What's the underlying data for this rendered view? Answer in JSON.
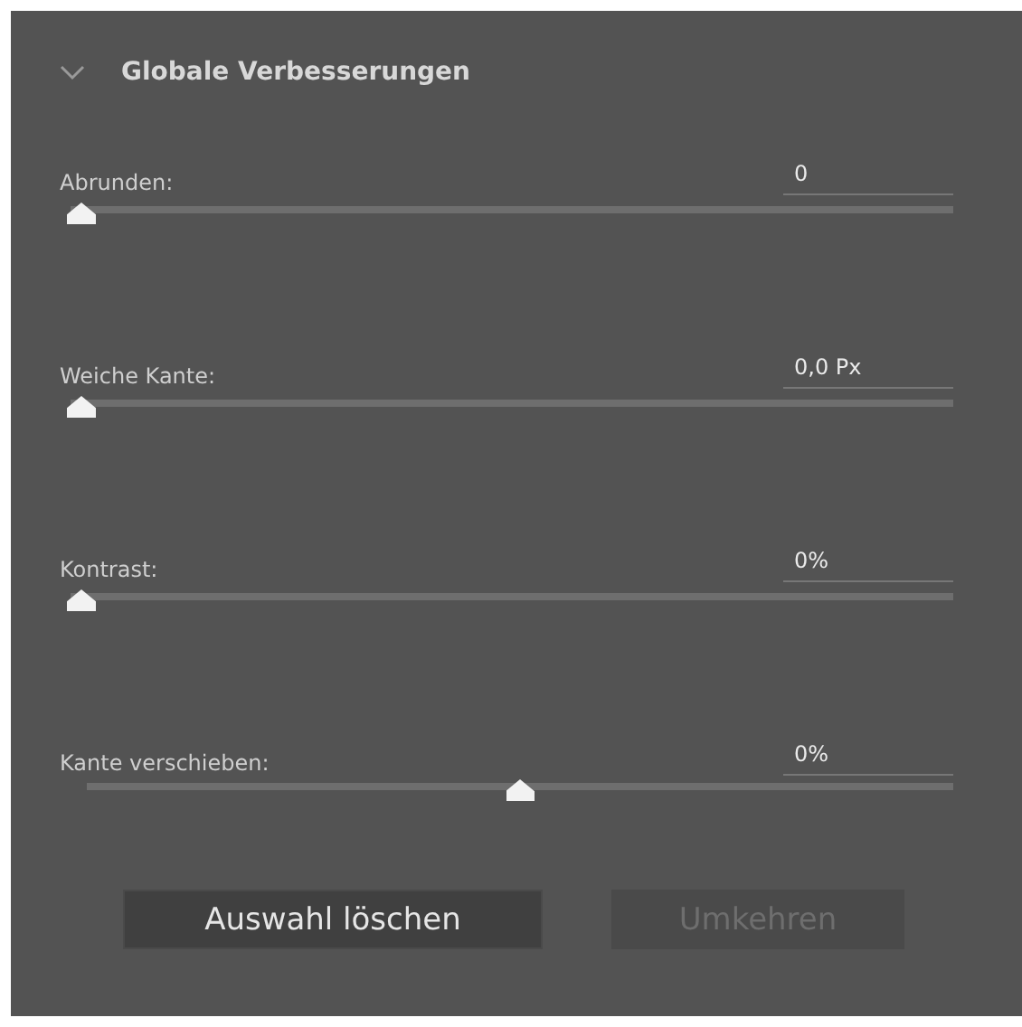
{
  "section": {
    "title": "Globale Verbesserungen",
    "expanded": true
  },
  "sliders": [
    {
      "label": "Abrunden:",
      "value": "0",
      "level": 0
    },
    {
      "label": "Weiche Kante:",
      "value": "0,0 Px",
      "level": 0
    },
    {
      "label": "Kontrast:",
      "value": "0%",
      "level": 0
    },
    {
      "label": "Kante verschieben:",
      "value": "0%",
      "level": 0.5
    }
  ],
  "buttons": [
    {
      "label": "Auswahl löschen",
      "disabled": false
    },
    {
      "label": "Umkehren",
      "disabled": true
    }
  ]
}
